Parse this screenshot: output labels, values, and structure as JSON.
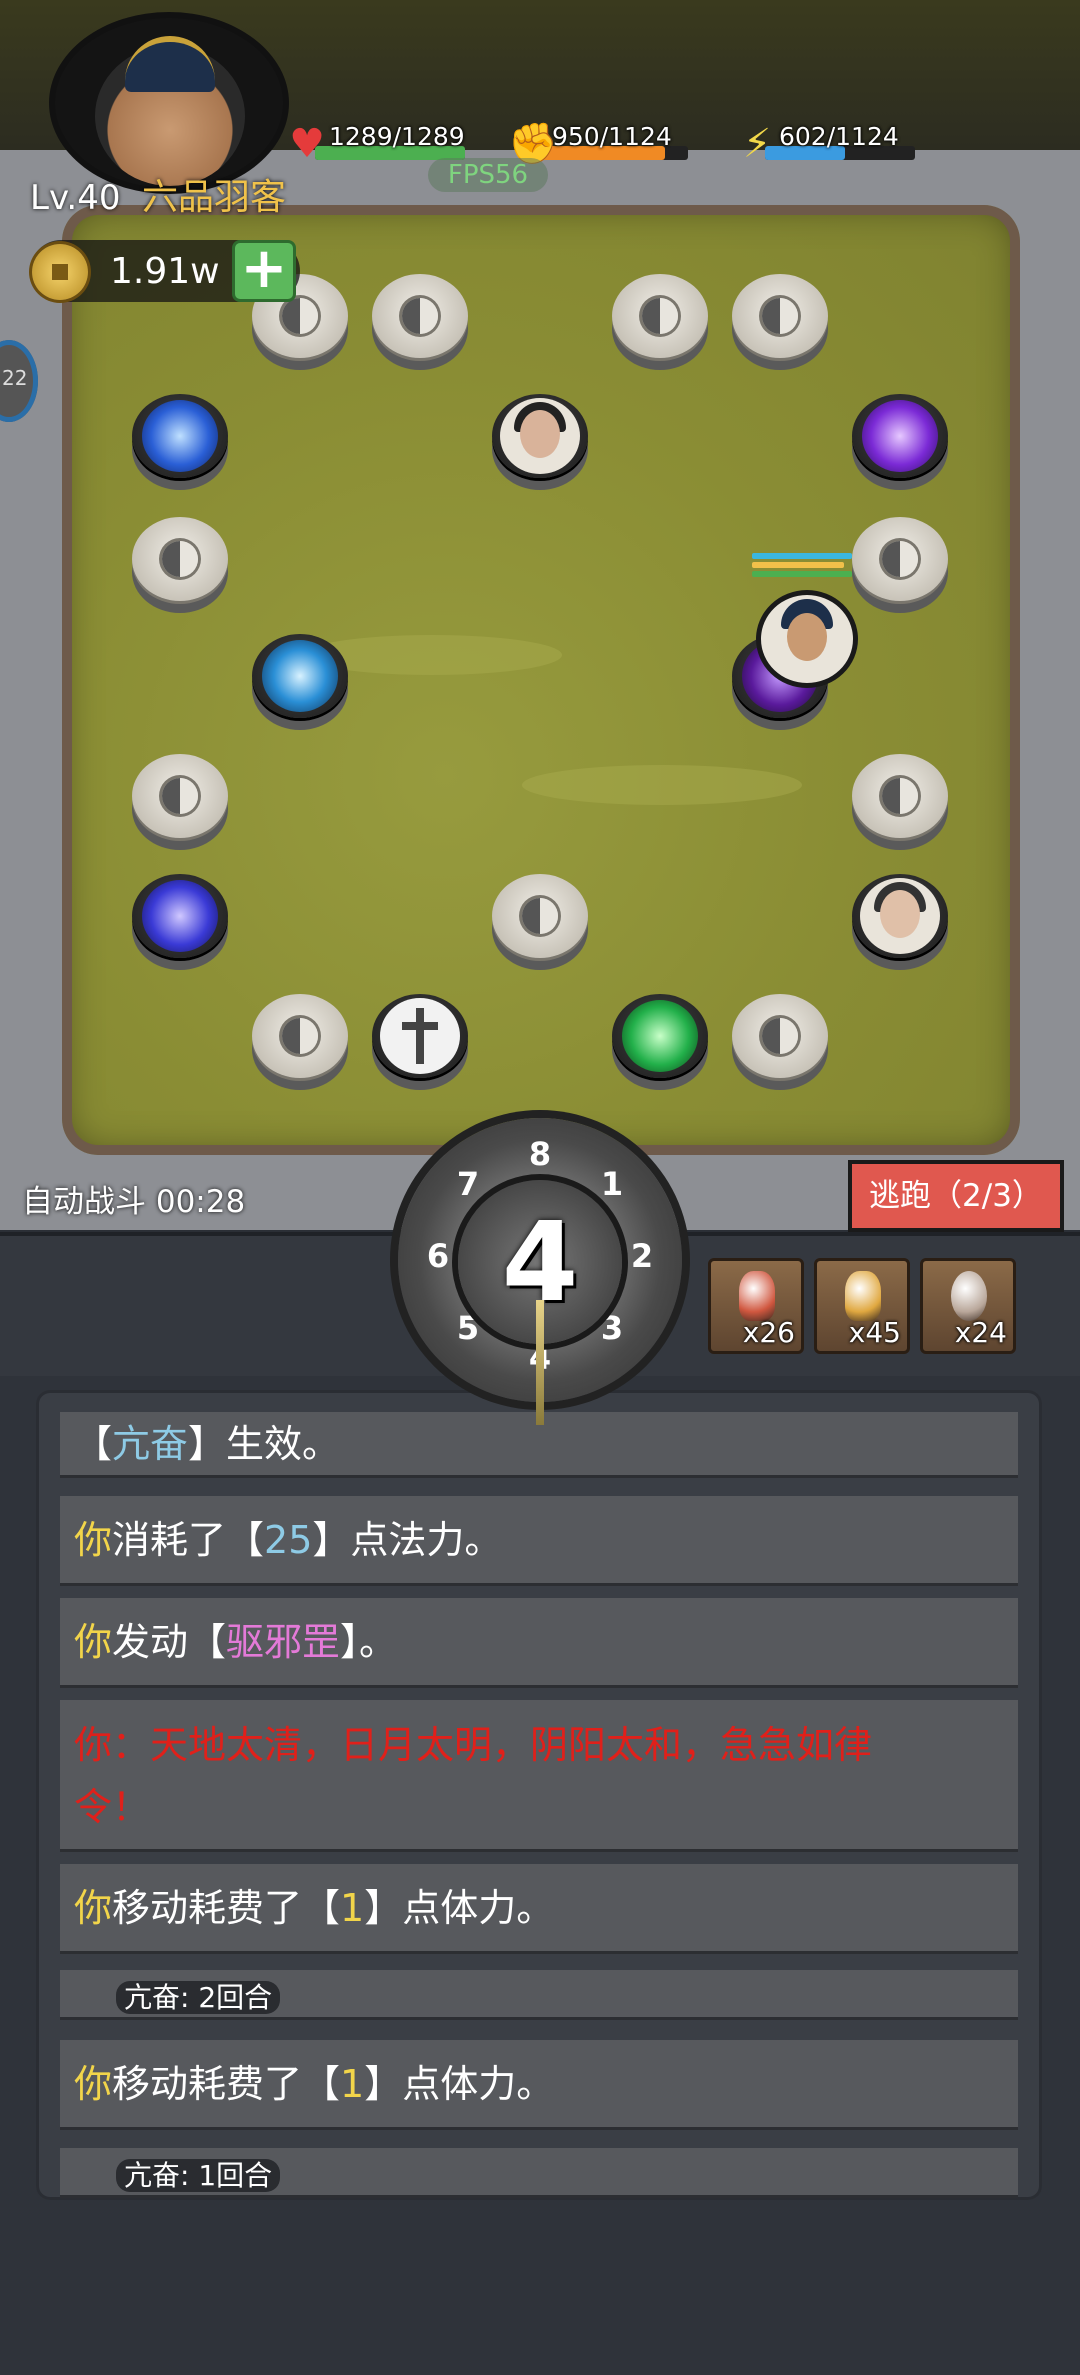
{
  "player": {
    "level": "Lv.40",
    "rank": "六品羽客",
    "coins": "1.91w",
    "hp": "1289/1289",
    "hp_fraction": 1.0,
    "stamina": "950/1124",
    "stamina_fraction": 0.845,
    "mana": "602/1124",
    "mana_fraction": 0.536
  },
  "fps": "FPS56",
  "side_tab": "22",
  "battle": {
    "auto_battle": "自动战斗 00:28",
    "escape_button": "逃跑（2/3）"
  },
  "dice": {
    "value": "4",
    "dial_numbers": [
      "8",
      "1",
      "2",
      "3",
      "4",
      "5",
      "6",
      "7"
    ]
  },
  "items": [
    {
      "name": "red-potion-icon",
      "count": "x26",
      "color": "#d0573f"
    },
    {
      "name": "yellow-potion-icon",
      "count": "x45",
      "color": "#e0a840"
    },
    {
      "name": "pearl-icon",
      "count": "x24",
      "color": "#b9a79a"
    }
  ],
  "log": {
    "l0_pre": "【",
    "l0_word": "亢奋",
    "l0_post": "】生效。",
    "l1_you": "你",
    "l1_a": "消耗了【",
    "l1_num": "25",
    "l1_b": "】点法力。",
    "l2_you": "你",
    "l2_a": "发动【",
    "l2_skill": "驱邪罡",
    "l2_b": "】。",
    "l3_line1": "你：天地太清，日月太明，阴阳太和，急急如律",
    "l3_line2": "令！",
    "l4_you": "你",
    "l4_a": "移动耗费了【",
    "l4_num": "1",
    "l4_b": "】点体力。",
    "l5_tag": "亢奋: 2回合",
    "l6_you": "你",
    "l6_a": "移动耗费了【",
    "l6_num": "1",
    "l6_b": "】点体力。",
    "l7_tag": "亢奋: 1回合"
  },
  "colors": {
    "board": "#8e9238",
    "escape": "#e0584f",
    "hp": "#4caf50",
    "stamina": "#f08a24",
    "mana": "#3b9be0"
  }
}
